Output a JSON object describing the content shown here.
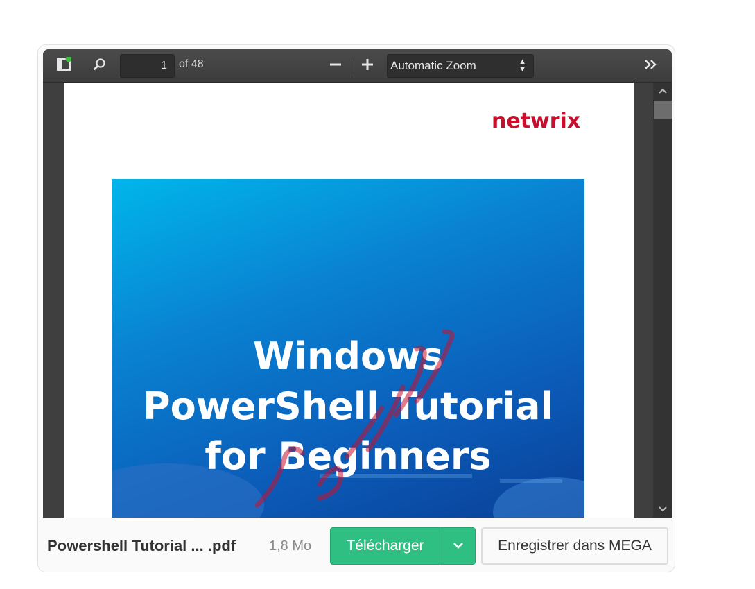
{
  "toolbar": {
    "sidebar_icon": "sidebar-toggle-icon",
    "search_icon": "search-icon",
    "page_number": "1",
    "page_count_label": "of 48",
    "zoom_out_icon": "minus-icon",
    "zoom_in_icon": "plus-icon",
    "zoom_value": "Automatic Zoom",
    "tools_icon": "double-chevron-right-icon",
    "notification_dot_color": "#3fbf3f"
  },
  "document": {
    "logo_text": "netwrix",
    "cover_title_lines": [
      "Windows",
      "PowerShell Tutorial",
      "for Beginners"
    ],
    "watermark_color": "#c8102e"
  },
  "footer": {
    "file_name": "Powershell Tutorial ... .pdf",
    "file_size": "1,8 Mo",
    "download_label": "Télécharger",
    "download_options_icon": "chevron-down-icon",
    "save_label": "Enregistrer dans MEGA",
    "accent_color": "#2fbf82"
  }
}
